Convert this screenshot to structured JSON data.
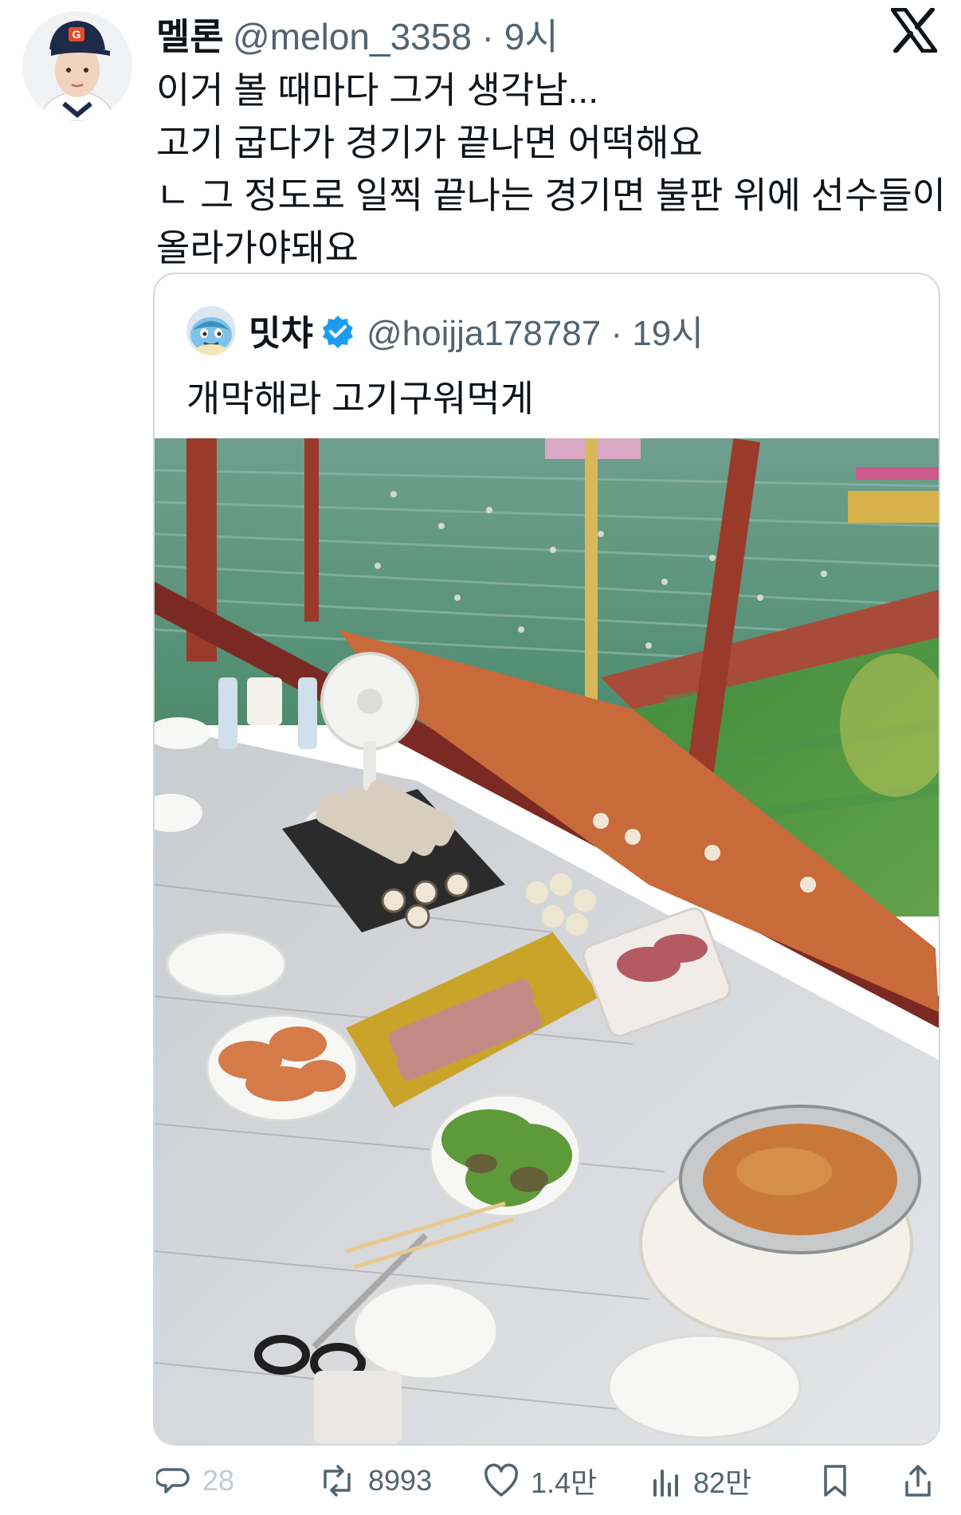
{
  "tweet": {
    "author_name": "멜론",
    "author_handle_time": "@melon_3358 · 9시",
    "lines": [
      "이거 볼 때마다 그거 생각남...",
      "고기 굽다가 경기가 끝나면 어떡해요",
      "ㄴ 그 정도로 일찍 끝나는 경기면 불판 위에 선수들이",
      "올라가야돼요"
    ]
  },
  "quote": {
    "author_name": "밋챠",
    "author_handle_time": "@hoijja178787 · 19시",
    "text": "개막해라 고기구워먹게",
    "verified_color": "#1d9bf0"
  },
  "actions": {
    "reply_count": "28",
    "retweet_count": "8993",
    "like_count": "1.4만",
    "view_count": "82만"
  },
  "icons": [
    "x-logo-icon",
    "verified-badge-icon",
    "reply-icon",
    "retweet-icon",
    "like-icon",
    "views-icon",
    "bookmark-icon",
    "share-icon"
  ]
}
